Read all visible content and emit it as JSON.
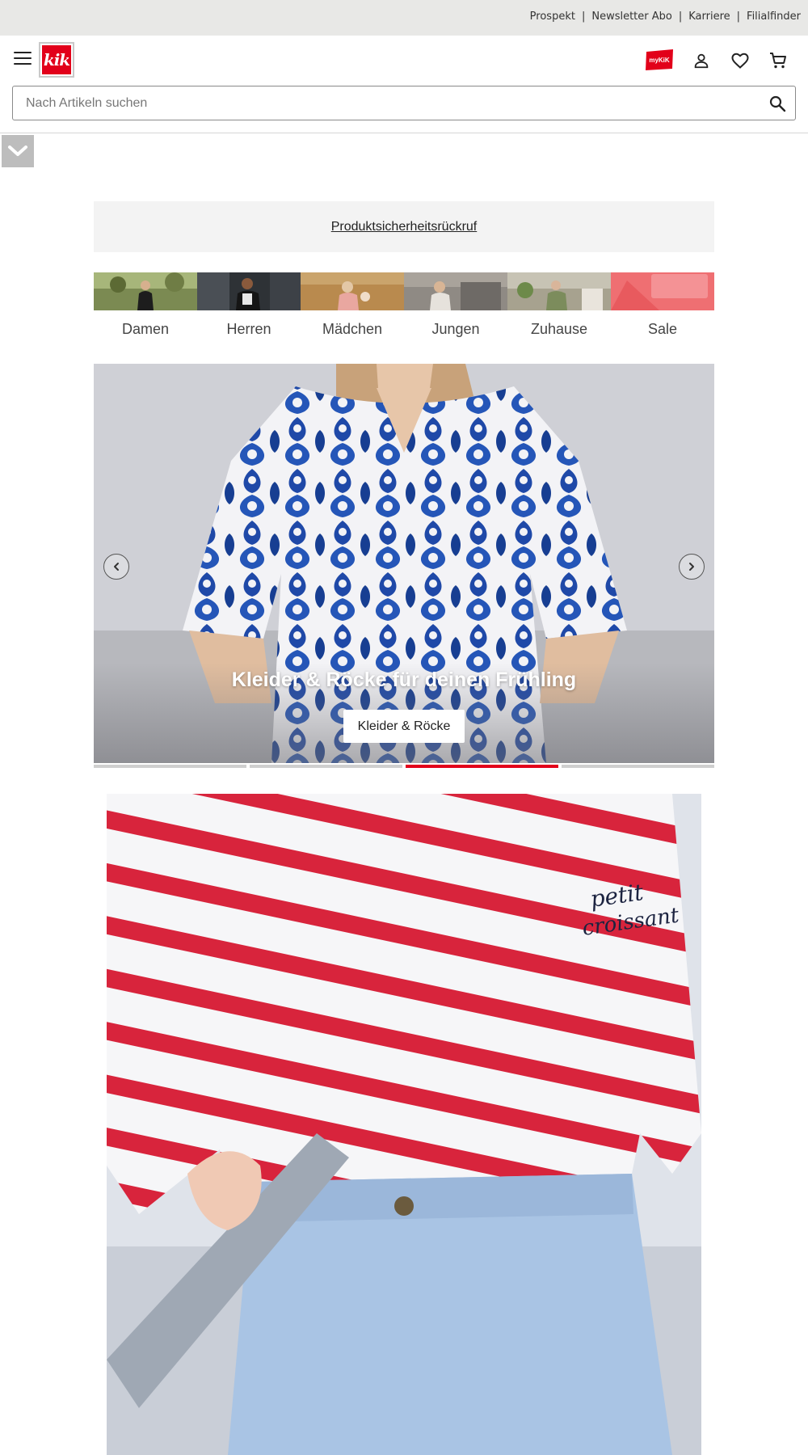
{
  "utility_nav": {
    "links": [
      "Prospekt",
      "Newsletter Abo",
      "Karriere",
      "Filialfinder"
    ],
    "separator": "|"
  },
  "header": {
    "logo_text": "kik",
    "mykik_text": "myKiK",
    "icons": [
      "menu-icon",
      "mykik-icon",
      "account-icon",
      "wishlist-icon",
      "cart-icon"
    ]
  },
  "search": {
    "placeholder": "Nach Artikeln suchen",
    "value": ""
  },
  "recall": {
    "link_text": "Produktsicherheitsrückruf"
  },
  "categories": [
    {
      "label": "Damen"
    },
    {
      "label": "Herren"
    },
    {
      "label": "Mädchen"
    },
    {
      "label": "Jungen"
    },
    {
      "label": "Zuhause"
    },
    {
      "label": "Sale"
    }
  ],
  "hero": {
    "title": "Kleider & Röcke für deinen Frühling",
    "cta_label": "Kleider & Röcke",
    "slide_count": 4,
    "active_slide": 3
  },
  "colors": {
    "brand_red": "#e2001a",
    "utility_bg": "#e8e8e6",
    "banner_bg": "#f3f3f3"
  }
}
